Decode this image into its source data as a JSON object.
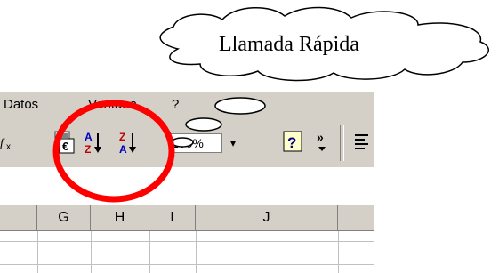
{
  "callout": {
    "text": "Llamada Rápida"
  },
  "menu": {
    "items": [
      {
        "label": "Datos"
      },
      {
        "label": "Ventana"
      },
      {
        "label": "?"
      }
    ]
  },
  "toolbar": {
    "icons": [
      "paste-function-icon",
      "euro-currency-icon",
      "sort-ascending-icon",
      "sort-descending-icon"
    ],
    "zoom_value": "100%",
    "zoom_dropdown": "▾",
    "help_icon": "?",
    "more_icon": "»"
  },
  "sheet": {
    "column_headers": [
      "G",
      "H",
      "I",
      "J"
    ]
  },
  "colors": {
    "highlight_circle": "#ff0000",
    "chrome": "#d4d0c8"
  }
}
